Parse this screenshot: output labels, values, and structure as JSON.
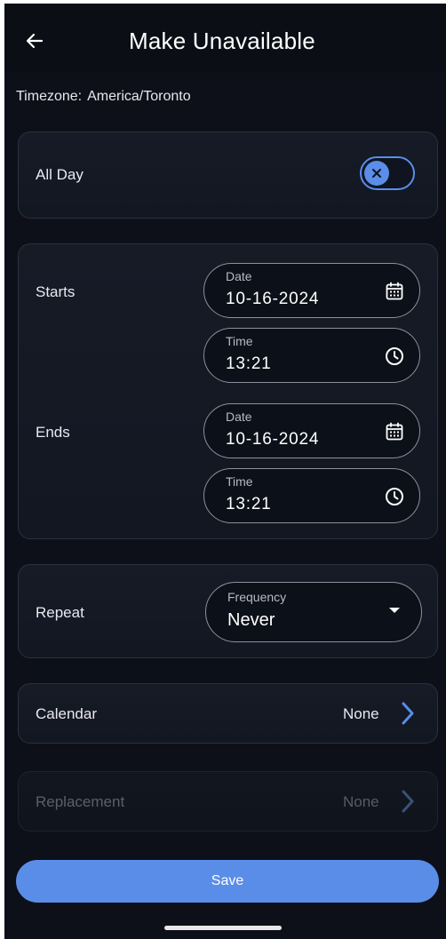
{
  "header": {
    "title": "Make Unavailable",
    "back_icon": "arrow-left-icon"
  },
  "timezone": {
    "label": "Timezone:",
    "value": "America/Toronto"
  },
  "all_day": {
    "label": "All Day",
    "toggle_state": "off",
    "toggle_icon": "close-icon"
  },
  "starts": {
    "label": "Starts",
    "date": {
      "label": "Date",
      "value": "10-16-2024",
      "icon": "calendar-icon"
    },
    "time": {
      "label": "Time",
      "value": "13:21",
      "icon": "clock-icon"
    }
  },
  "ends": {
    "label": "Ends",
    "date": {
      "label": "Date",
      "value": "10-16-2024",
      "icon": "calendar-icon"
    },
    "time": {
      "label": "Time",
      "value": "13:21",
      "icon": "clock-icon"
    }
  },
  "repeat": {
    "label": "Repeat",
    "frequency": {
      "label": "Frequency",
      "value": "Never"
    }
  },
  "calendar": {
    "label": "Calendar",
    "value": "None"
  },
  "replacement": {
    "label": "Replacement",
    "value": "None",
    "disabled": true
  },
  "save": {
    "label": "Save"
  },
  "colors": {
    "background": "#0d1018",
    "accent": "#5a8de8",
    "text": "#e8eaf0",
    "disabled_text": "#5a606b"
  }
}
